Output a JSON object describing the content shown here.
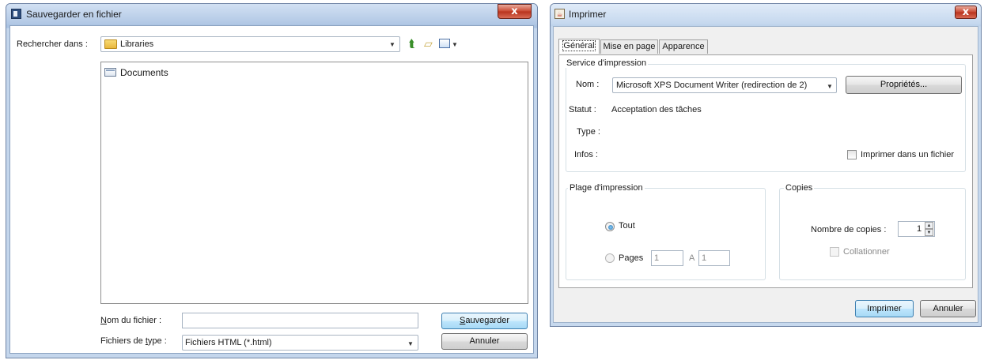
{
  "save_dialog": {
    "title": "Sauvegarder en fichier",
    "close_glyph": "x",
    "look_in_label": "Rechercher dans :",
    "look_in_value": "Libraries",
    "files": [
      {
        "name": "Documents",
        "icon": "folder-icon"
      }
    ],
    "file_name_label": "Nom du fichier :",
    "file_name_value": "",
    "file_type_label": "Fichiers de type :",
    "file_type_value": "Fichiers HTML (*.html)",
    "save_button": "Sauvegarder",
    "cancel_button": "Annuler"
  },
  "print_dialog": {
    "title": "Imprimer",
    "close_glyph": "x",
    "tabs": [
      {
        "label": "Général",
        "selected": true
      },
      {
        "label": "Mise en page",
        "selected": false
      },
      {
        "label": "Apparence",
        "selected": false
      }
    ],
    "service": {
      "group_title": "Service d'impression",
      "name_label": "Nom :",
      "name_value": "Microsoft XPS Document Writer (redirection de 2)",
      "properties_button": "Propriétés...",
      "status_label": "Statut :",
      "status_value": "Acceptation des tâches",
      "type_label": "Type :",
      "info_label": "Infos :",
      "print_to_file_label": "Imprimer dans un fichier",
      "print_to_file_checked": false
    },
    "range": {
      "group_title": "Plage d'impression",
      "all_label": "Tout",
      "pages_label": "Pages",
      "from_value": "1",
      "to_label": "A",
      "to_value": "1",
      "selected": "all"
    },
    "copies": {
      "group_title": "Copies",
      "count_label": "Nombre de copies :",
      "count_value": "1",
      "collate_label": "Collationner",
      "collate_checked": false
    },
    "print_button": "Imprimer",
    "cancel_button": "Annuler"
  },
  "colors": {
    "title_bar": "#b0c7e4",
    "close_button": "#c8462f",
    "default_button_border": "#3c7fb1",
    "radio_selected": "#1e6fb6"
  }
}
